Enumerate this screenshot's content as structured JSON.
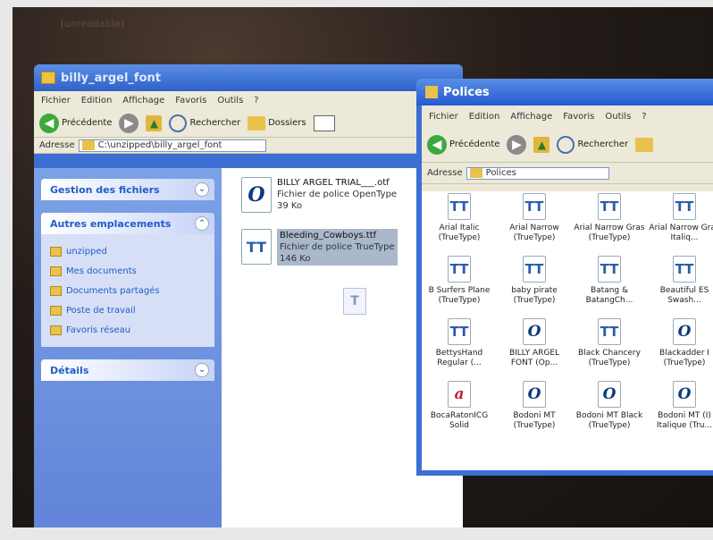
{
  "desktop": {
    "title_faint": "[unreadable]"
  },
  "window1": {
    "title": "billy_argel_font",
    "menu": [
      "Fichier",
      "Edition",
      "Affichage",
      "Favoris",
      "Outils",
      "?"
    ],
    "toolbar": {
      "back": "Précédente",
      "search": "Rechercher",
      "folders": "Dossiers"
    },
    "address_label": "Adresse",
    "address_value": "C:\\unzipped\\billy_argel_font",
    "tasks": [
      {
        "title": "Gestion des fichiers",
        "items": []
      },
      {
        "title": "Autres emplacements",
        "items": [
          "unzipped",
          "Mes documents",
          "Documents partagés",
          "Poste de travail",
          "Favoris réseau"
        ]
      },
      {
        "title": "Détails",
        "items": []
      }
    ],
    "files": [
      {
        "name": "BILLY ARGEL TRIAL___.otf",
        "type": "Fichier de police OpenType",
        "size": "39 Ko",
        "icon": "O"
      },
      {
        "name": "Bleeding_Cowboys.ttf",
        "type": "Fichier de police TrueType",
        "size": "146 Ko",
        "icon": "TT"
      }
    ]
  },
  "window2": {
    "title": "Polices",
    "menu": [
      "Fichier",
      "Edition",
      "Affichage",
      "Favoris",
      "Outils",
      "?"
    ],
    "toolbar": {
      "back": "Précédente",
      "search": "Rechercher"
    },
    "address_label": "Adresse",
    "address_value": "Polices",
    "fonts": [
      {
        "label": "Arial Italic (TrueType)",
        "icon": "TT"
      },
      {
        "label": "Arial Narrow (TrueType)",
        "icon": "TT"
      },
      {
        "label": "Arial Narrow Gras (TrueType)",
        "icon": "TT"
      },
      {
        "label": "Arial Narrow Gras Italiq...",
        "icon": "TT"
      },
      {
        "label": "B Surfers Plane (TrueType)",
        "icon": "TT"
      },
      {
        "label": "baby pirate (TrueType)",
        "icon": "TT"
      },
      {
        "label": "Batang & BatangCh...",
        "icon": "TT"
      },
      {
        "label": "Beautiful ES Swash...",
        "icon": "TT"
      },
      {
        "label": "BettysHand Regular (...",
        "icon": "TT"
      },
      {
        "label": "BILLY ARGEL FONT (Op...",
        "icon": "O"
      },
      {
        "label": "Black Chancery (TrueType)",
        "icon": "TT"
      },
      {
        "label": "Blackadder I (TrueType)",
        "icon": "O"
      },
      {
        "label": "BocaRatonICG Solid",
        "icon": "a"
      },
      {
        "label": "Bodoni MT (TrueType)",
        "icon": "O"
      },
      {
        "label": "Bodoni MT Black (TrueType)",
        "icon": "O"
      },
      {
        "label": "Bodoni MT (I) Italique (Tru...",
        "icon": "O"
      }
    ]
  }
}
